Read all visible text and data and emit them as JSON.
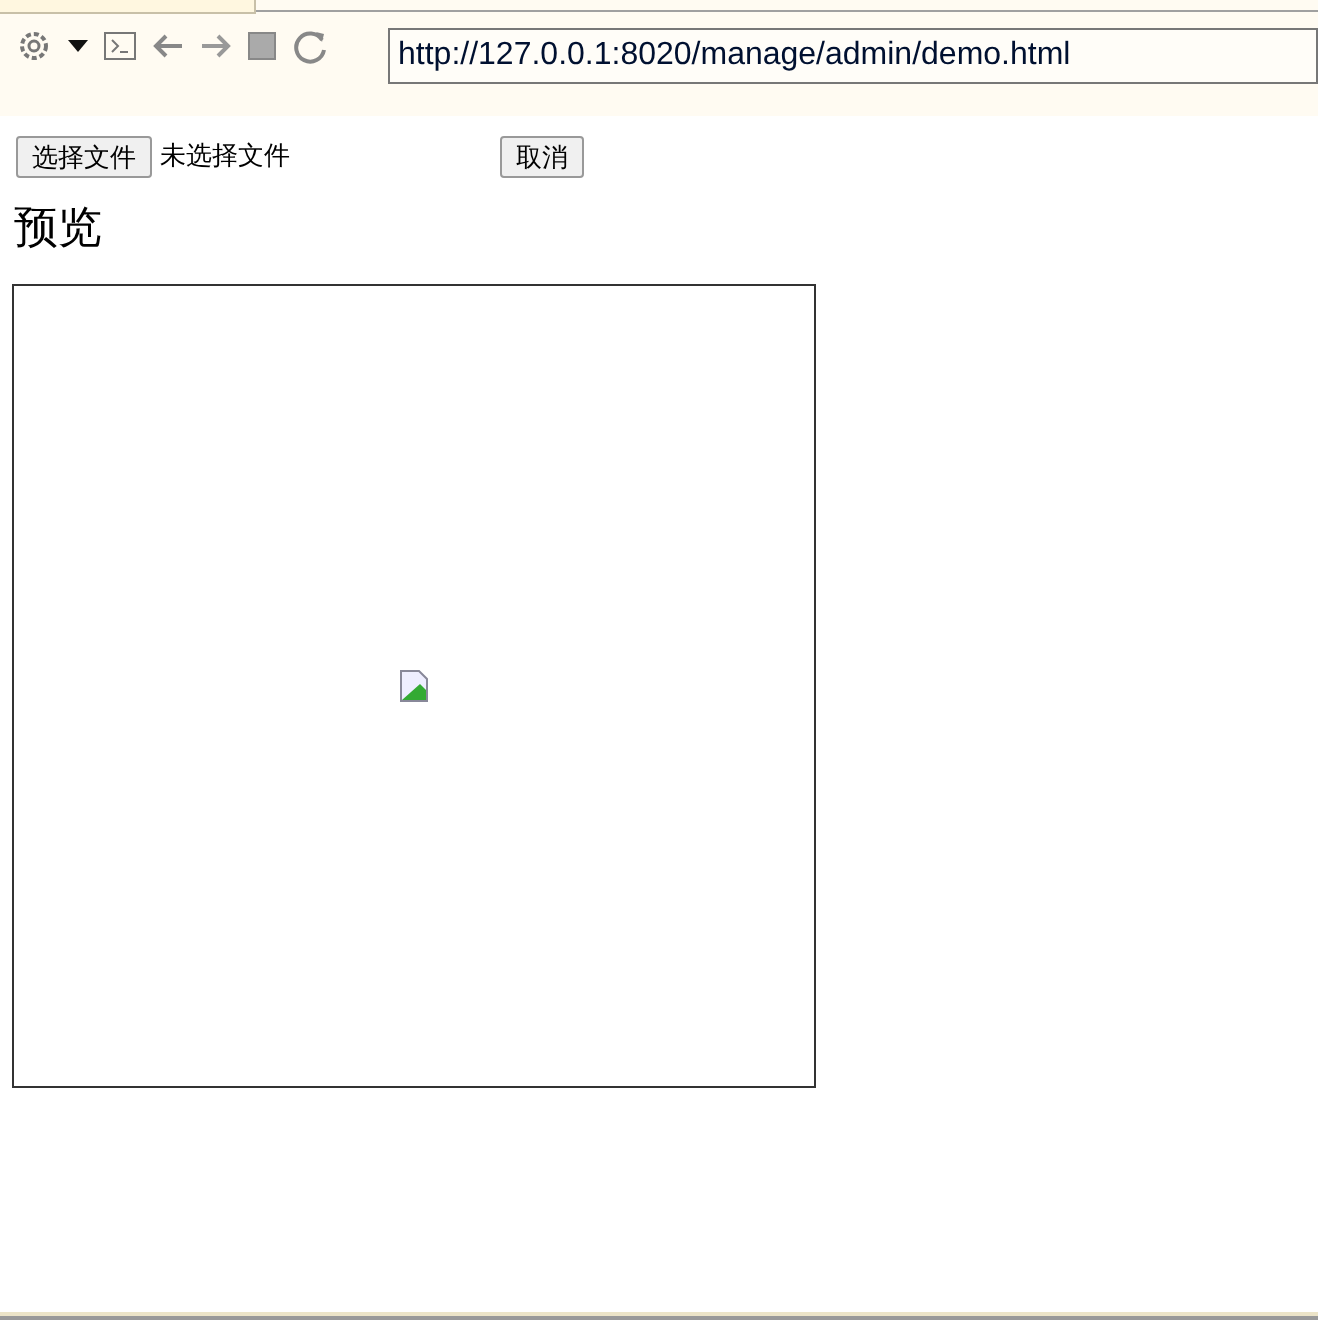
{
  "address_bar": {
    "url": "http://127.0.0.1:8020/manage/admin/demo.html"
  },
  "file_input": {
    "button": "选择文件",
    "status": "未选择文件"
  },
  "cancel_button": "取消",
  "heading": "预览"
}
